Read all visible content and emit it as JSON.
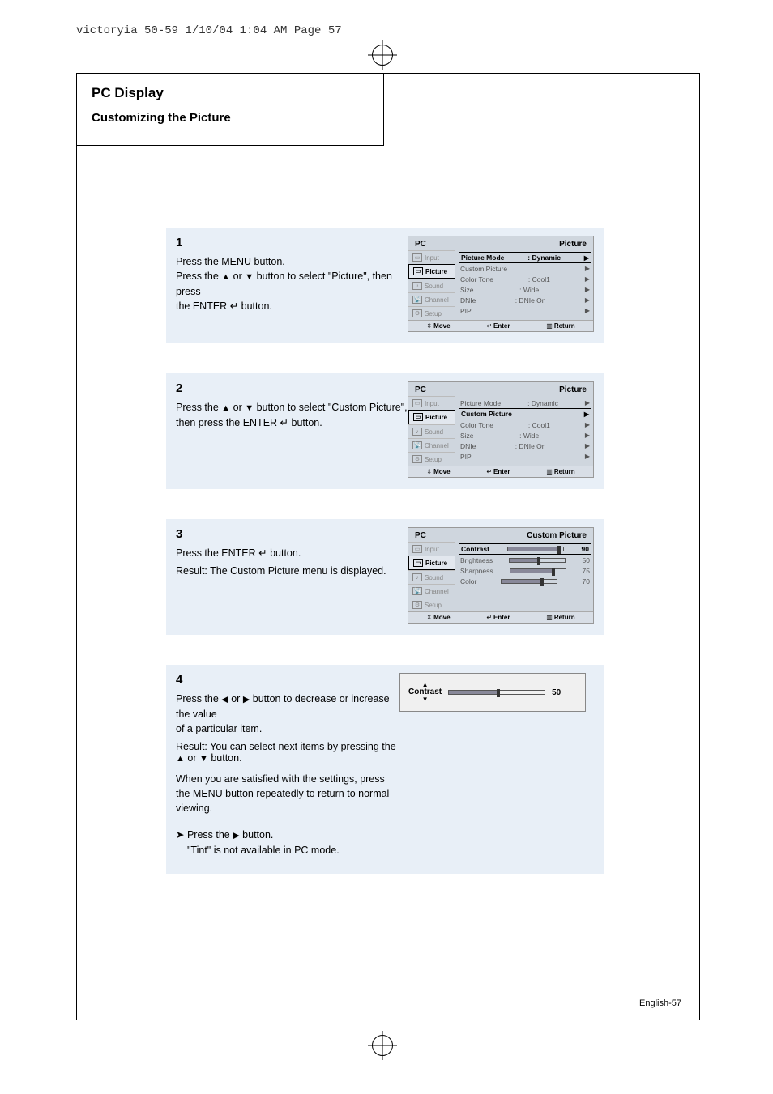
{
  "prepress_header": "victoryia 50-59  1/10/04 1:04 AM  Page 57",
  "topbox": {
    "big_title": "PC Display",
    "sub_title": "Customizing the Picture"
  },
  "step1": {
    "num": "1",
    "line1": "Press the MENU button.",
    "line2a": "Press the ",
    "line2b": " or ",
    "line2c": " button to select \"Picture\", then press",
    "line3a": "the ENTER ",
    "line3b": " button."
  },
  "step2": {
    "num": "2",
    "line1a": "Press the ",
    "line1b": " or ",
    "line1c": " button to select \"Custom Picture\",",
    "line2a": "then press the ENTER ",
    "line2b": " button."
  },
  "step3": {
    "num": "3",
    "line1a": "Press the ENTER ",
    "line1b": " button.",
    "result": "Result: The Custom Picture menu is displayed."
  },
  "step4": {
    "num": "4",
    "line1a": "Press the ",
    "line1b": " or ",
    "line1c": " button to decrease or increase the value",
    "line2": "of a particular item.",
    "result_a": "Result: You can select next items by pressing the ",
    "result_b": " or ",
    "result_c": " button.",
    "tail": "When you are satisfied with the settings, press the MENU button repeatedly to return to normal viewing.",
    "note_a": "Press the ",
    "note_b": " button.",
    "note_c": "\"Tint\" is not available in PC mode."
  },
  "osd_common": {
    "pc": "PC",
    "picture": "Picture",
    "custom_picture": "Custom Picture",
    "side": {
      "input": "Input",
      "picture": "Picture",
      "sound": "Sound",
      "channel": "Channel",
      "setup": "Setup"
    },
    "footer": {
      "move": "Move",
      "enter": "Enter",
      "return": "Return"
    }
  },
  "osd1": {
    "rows": [
      {
        "l": "Picture Mode",
        "m": ":  Dynamic",
        "sel": true
      },
      {
        "l": "Custom Picture",
        "m": ""
      },
      {
        "l": "Color Tone",
        "m": ":  Cool1"
      },
      {
        "l": "Size",
        "m": ":  Wide"
      },
      {
        "l": "DNIe",
        "m": ":  DNIe On"
      },
      {
        "l": "PIP",
        "m": ""
      }
    ]
  },
  "osd2": {
    "rows": [
      {
        "l": "Picture Mode",
        "m": ":  Dynamic"
      },
      {
        "l": "Custom Picture",
        "m": "",
        "sel": true
      },
      {
        "l": "Color Tone",
        "m": ":  Cool1"
      },
      {
        "l": "Size",
        "m": ":  Wide"
      },
      {
        "l": "DNIe",
        "m": ":  DNIe On"
      },
      {
        "l": "PIP",
        "m": ""
      }
    ]
  },
  "osd3": {
    "rows": [
      {
        "l": "Contrast",
        "v": "90",
        "sel": true,
        "p": 90
      },
      {
        "l": "Brightness",
        "v": "50",
        "p": 50
      },
      {
        "l": "Sharpness",
        "v": "75",
        "p": 75
      },
      {
        "l": "Color",
        "v": "70",
        "p": 70
      }
    ]
  },
  "contrast_popup": {
    "label": "Contrast",
    "value": "50"
  },
  "page_number_label": "English-57"
}
